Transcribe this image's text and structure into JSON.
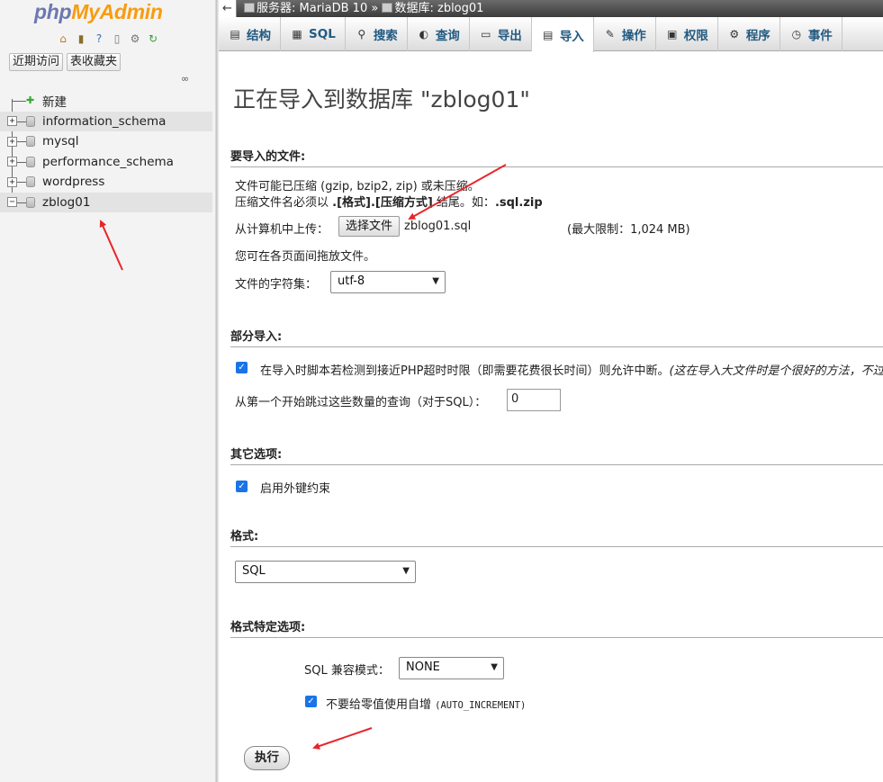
{
  "nav": {
    "logo_php": "php",
    "logo_myadmin": "MyAdmin",
    "quick_icons": [
      "home-icon",
      "exit-icon",
      "help-icon",
      "docs-icon",
      "settings-icon",
      "reload-icon"
    ],
    "recent_label": "近期访问",
    "favorites_label": "表收藏夹",
    "tree": [
      {
        "label": "新建",
        "type": "new"
      },
      {
        "label": "information_schema",
        "type": "db",
        "expander": "+"
      },
      {
        "label": "mysql",
        "type": "db",
        "expander": "+"
      },
      {
        "label": "performance_schema",
        "type": "db",
        "expander": "+"
      },
      {
        "label": "wordpress",
        "type": "db",
        "expander": "+"
      },
      {
        "label": "zblog01",
        "type": "db",
        "expander": "−"
      }
    ]
  },
  "breadcrumb": {
    "server_label": "服务器: MariaDB 10",
    "separator": "»",
    "database_label": "数据库: zblog01"
  },
  "tabs": [
    {
      "label": "结构",
      "icon": "structure-icon",
      "glyph": "▤"
    },
    {
      "label": "SQL",
      "icon": "sql-icon",
      "glyph": "▦"
    },
    {
      "label": "搜索",
      "icon": "search-icon",
      "glyph": "⚲"
    },
    {
      "label": "查询",
      "icon": "query-icon",
      "glyph": "◐"
    },
    {
      "label": "导出",
      "icon": "export-icon",
      "glyph": "▭"
    },
    {
      "label": "导入",
      "icon": "import-icon",
      "glyph": "▤"
    },
    {
      "label": "操作",
      "icon": "wrench-icon",
      "glyph": "✎"
    },
    {
      "label": "权限",
      "icon": "privileges-icon",
      "glyph": "▣"
    },
    {
      "label": "程序",
      "icon": "routines-icon",
      "glyph": "⚙"
    },
    {
      "label": "事件",
      "icon": "events-icon",
      "glyph": "◷"
    }
  ],
  "main": {
    "title": "正在导入到数据库 \"zblog01\"",
    "file_section": {
      "heading": "要导入的文件:",
      "line1": "文件可能已压缩 (gzip, bzip2, zip) 或未压缩。",
      "line2_prefix": "压缩文件名必须以 ",
      "line2_bold": ".[格式].[压缩方式]",
      "line2_mid": " 结尾。如：",
      "line2_ext": ".sql.zip",
      "upload_label": "从计算机中上传：",
      "choose_file_button": "选择文件",
      "chosen_file": "zblog01.sql",
      "max_limit": "(最大限制：1,024 MB)",
      "drag_hint": "您可在各页面间拖放文件。",
      "charset_label": "文件的字符集：",
      "charset_value": "utf-8"
    },
    "partial_section": {
      "heading": "部分导入:",
      "allow_interrupt_label": "在导入时脚本若检测到接近PHP超时时限（即需要花费很长时间）则允许中断。",
      "allow_interrupt_hint": "(这在导入大文件时是个很好的方法，不过",
      "skip_label": "从第一个开始跳过这些数量的查询（对于SQL）：",
      "skip_value": "0"
    },
    "other_section": {
      "heading": "其它选项:",
      "fk_label": "启用外键约束"
    },
    "format_section": {
      "heading": "格式:",
      "format_value": "SQL"
    },
    "format_specific_section": {
      "heading": "格式特定选项:",
      "compat_label": "SQL 兼容模式：",
      "compat_value": "NONE",
      "no_auto_value_label": "不要给零值使用自增",
      "no_auto_value_code": "(AUTO_INCREMENT)"
    },
    "go_button": "执行"
  },
  "colors": {
    "tab_text": "#235a81",
    "annotation_arrow": "#e8262a",
    "checkbox": "#1a73e8"
  }
}
